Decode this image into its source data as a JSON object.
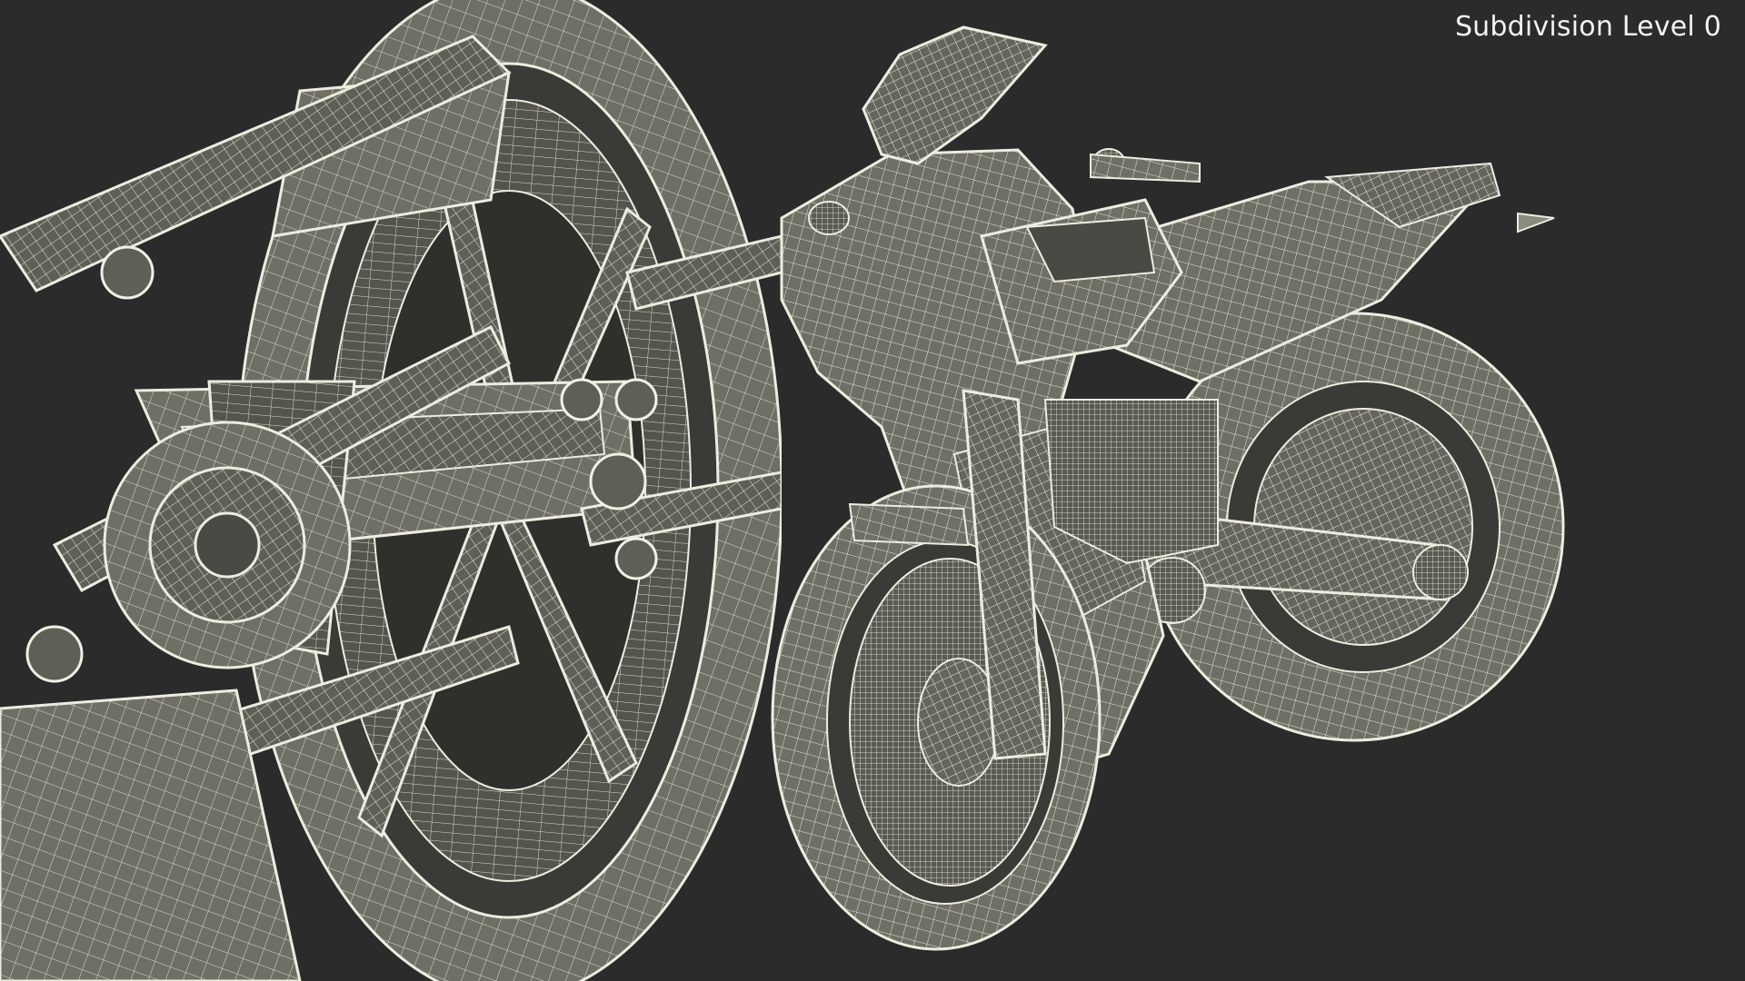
{
  "overlay": {
    "label": "Subdivision Level 0"
  },
  "colors": {
    "background": "#2b2b2b",
    "surface": "#6f6f66",
    "wire": "#e9e9dc"
  },
  "views": [
    {
      "name": "rear-wheel-closeup",
      "icon": "wireframe-rear-swingarm-closeup"
    },
    {
      "name": "motorcycle-full",
      "icon": "wireframe-motorcycle-three-quarter"
    }
  ]
}
